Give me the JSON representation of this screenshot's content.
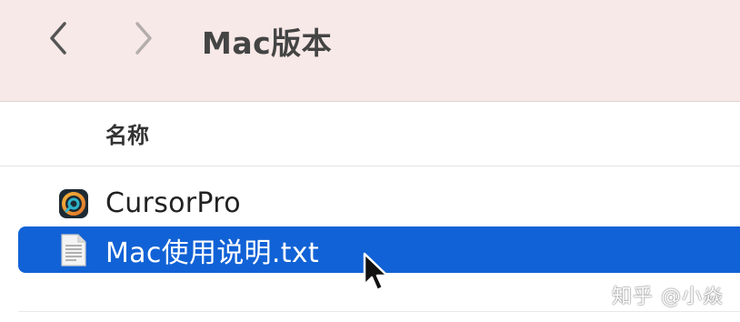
{
  "toolbar": {
    "title": "Mac版本",
    "back_icon": "chevron-left-icon",
    "forward_icon": "chevron-right-icon"
  },
  "list_header": {
    "name_column": "名称"
  },
  "files": [
    {
      "name": "CursorPro",
      "icon": "app-icon",
      "selected": false
    },
    {
      "name": "Mac使用说明.txt",
      "icon": "text-document-icon",
      "selected": true
    }
  ],
  "watermark": "知乎 @小焱",
  "colors": {
    "toolbar_bg": "#f7e9e7",
    "selection": "#1162d6",
    "title_text": "#444444"
  }
}
